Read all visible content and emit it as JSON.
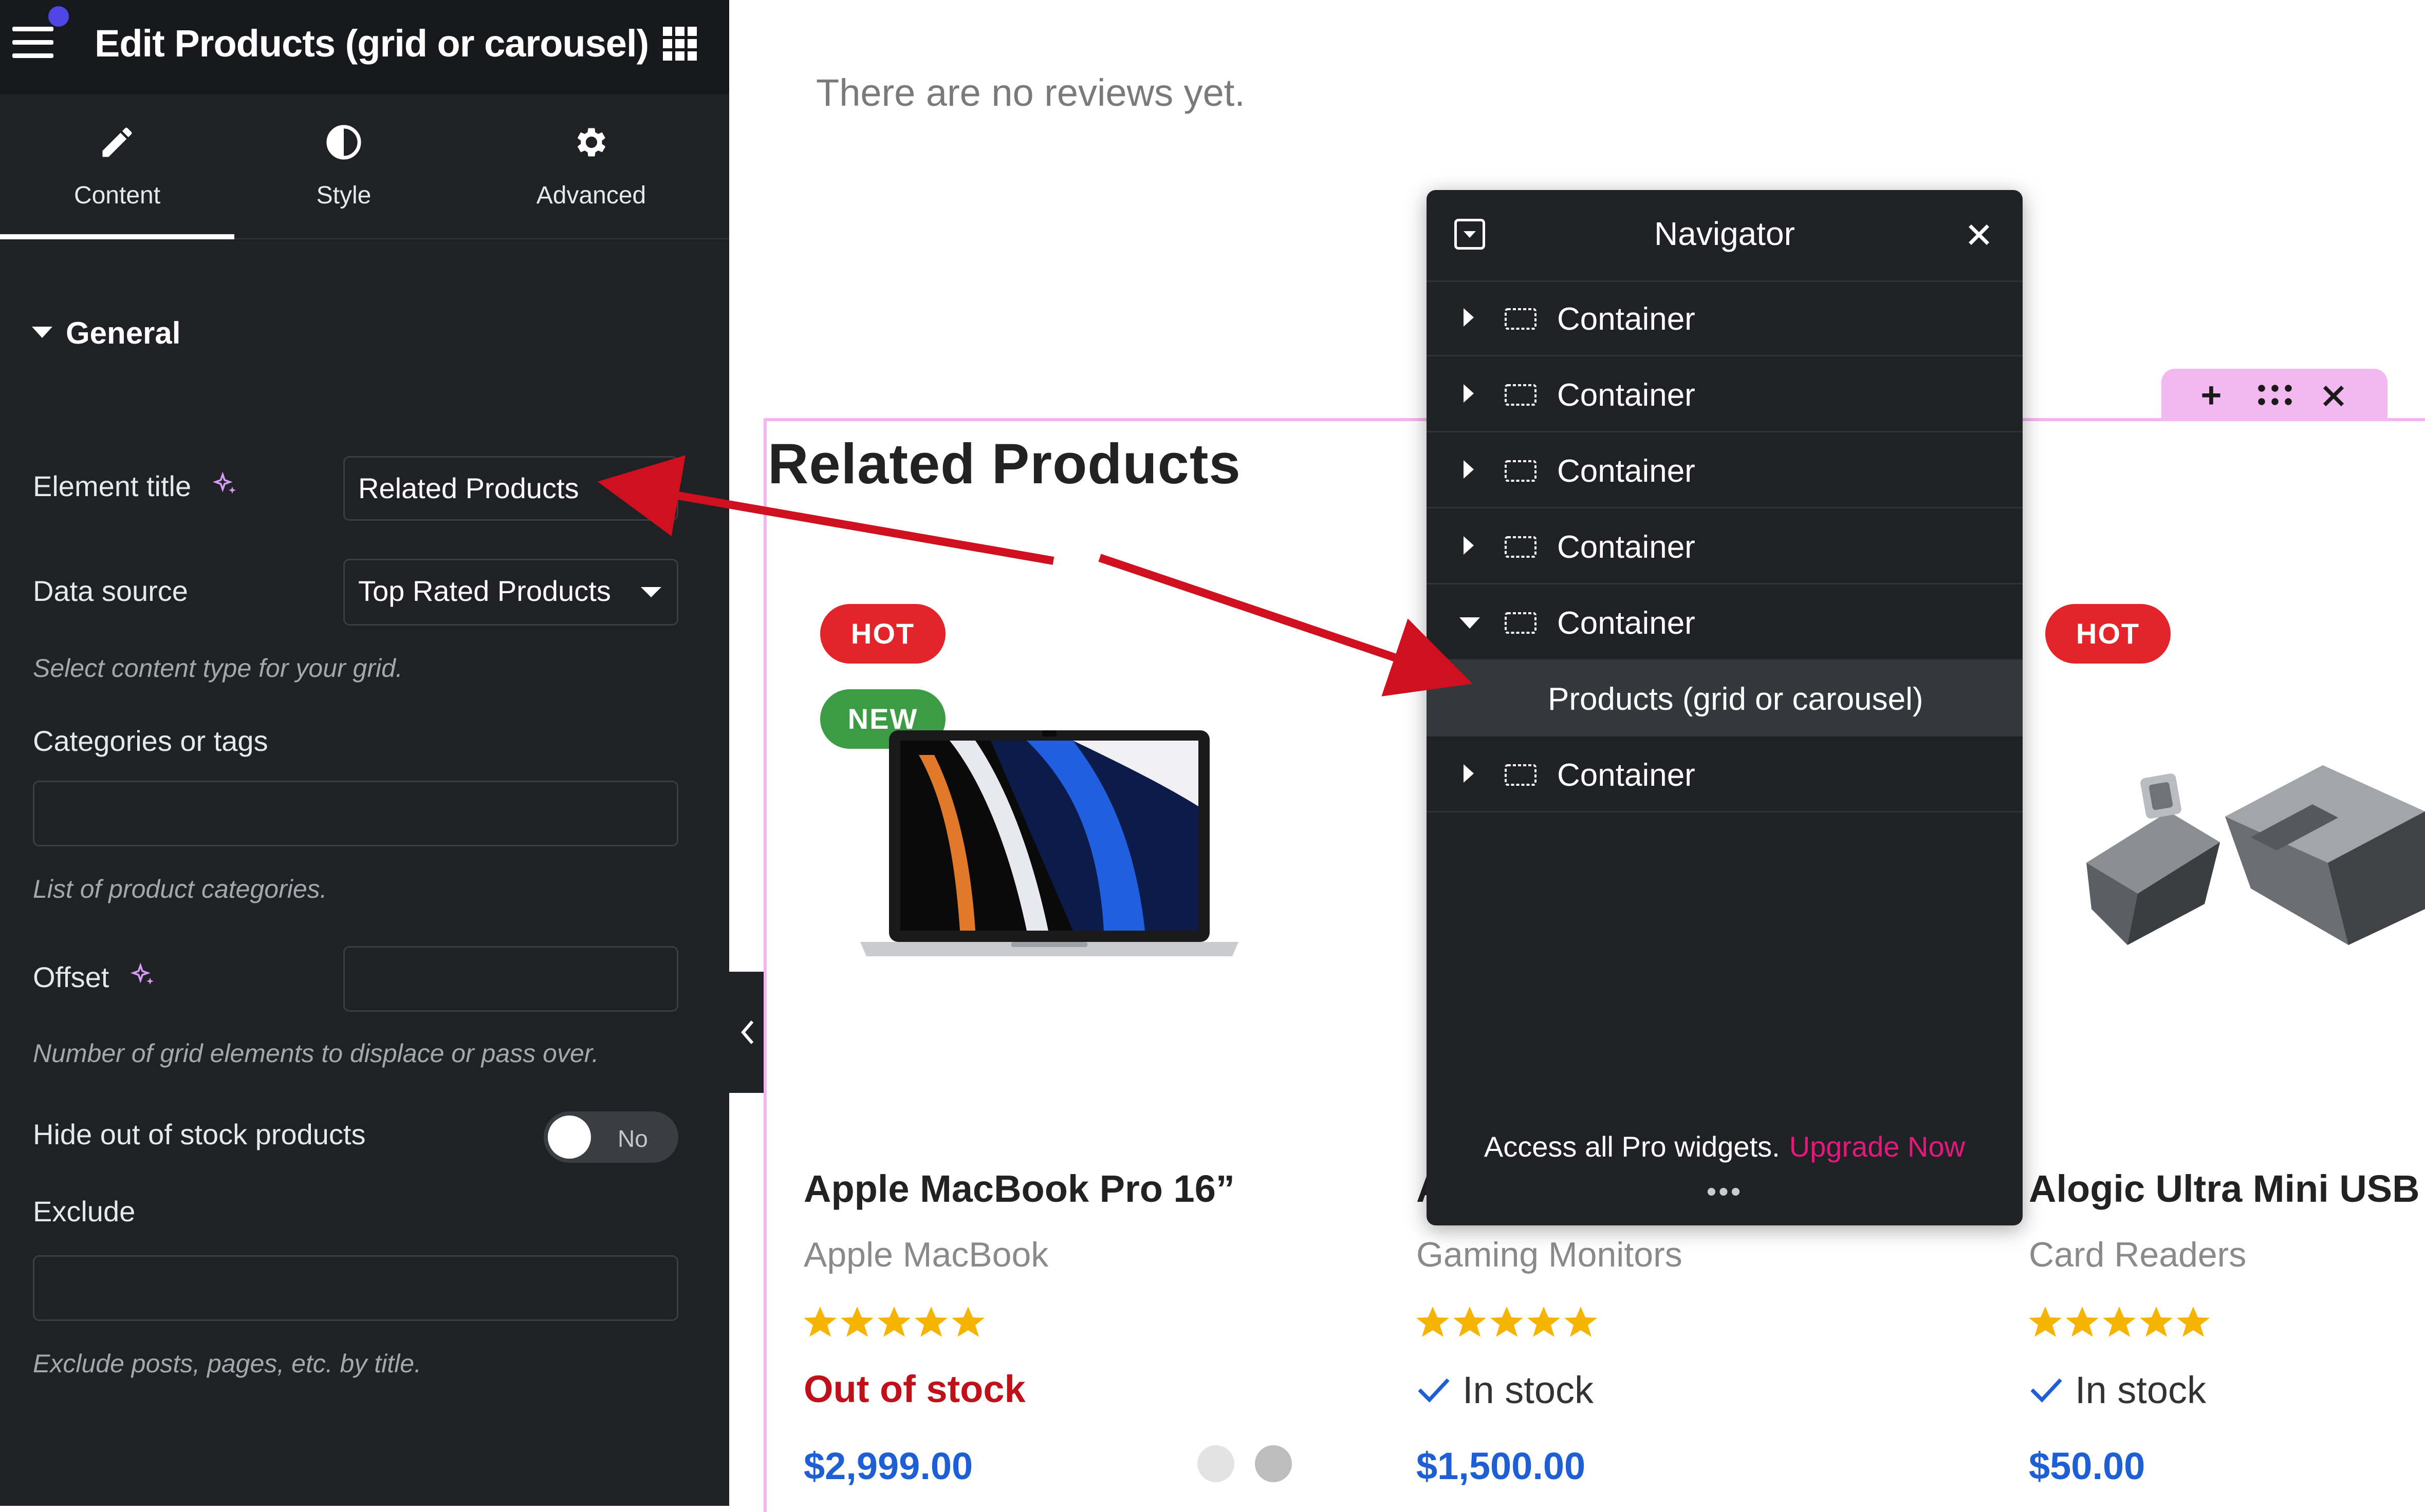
{
  "editor": {
    "title": "Edit Products (grid or carousel)",
    "tabs": [
      {
        "label": "Content"
      },
      {
        "label": "Style"
      },
      {
        "label": "Advanced"
      }
    ],
    "section": "General",
    "element_title": {
      "label": "Element title",
      "value": "Related Products"
    },
    "data_source": {
      "label": "Data source",
      "value": "Top Rated Products",
      "help": "Select content type for your grid."
    },
    "categories": {
      "label": "Categories or tags",
      "value": "",
      "help": "List of product categories."
    },
    "offset": {
      "label": "Offset",
      "value": "",
      "help": "Number of grid elements to displace or pass over."
    },
    "hide_out_of_stock": {
      "label": "Hide out of stock products",
      "state": "No"
    },
    "exclude": {
      "label": "Exclude",
      "value": "",
      "help": "Exclude posts, pages, etc. by title."
    }
  },
  "page": {
    "reviews_text": "There are no reviews yet.",
    "section_title": "Related Products",
    "products": [
      {
        "name": "Apple MacBook Pro 16”",
        "category": "Apple MacBook",
        "stock": "Out of stock",
        "price": "$2,999.00",
        "badges": [
          "HOT",
          "NEW"
        ],
        "rating": 5
      },
      {
        "name": "A",
        "category": "Gaming Monitors",
        "stock": "In stock",
        "price": "$1,500.00",
        "badges": [],
        "rating": 5
      },
      {
        "name": "Alogic Ultra Mini USB",
        "category": "Card Readers",
        "stock": "In stock",
        "price": "$50.00",
        "badges": [
          "HOT"
        ],
        "rating": 5
      }
    ]
  },
  "navigator": {
    "title": "Navigator",
    "items": [
      {
        "label": "Container",
        "expanded": false
      },
      {
        "label": "Container",
        "expanded": false
      },
      {
        "label": "Container",
        "expanded": false
      },
      {
        "label": "Container",
        "expanded": false
      },
      {
        "label": "Container",
        "expanded": true
      },
      {
        "label": "Products (grid or carousel)",
        "selected": true
      },
      {
        "label": "Container",
        "expanded": false
      }
    ],
    "footer_text": "Access all Pro widgets.",
    "upgrade_label": "Upgrade Now"
  },
  "colors": {
    "panel_bg": "#1f2124",
    "accent_pink": "#e3197e",
    "hot_badge": "#e3242b",
    "new_badge": "#3e9b45",
    "price_blue": "#1e5fd6",
    "out_of_stock_red": "#c0111a",
    "star_gold": "#f4b400",
    "annotation_arrow": "#d0101e"
  }
}
